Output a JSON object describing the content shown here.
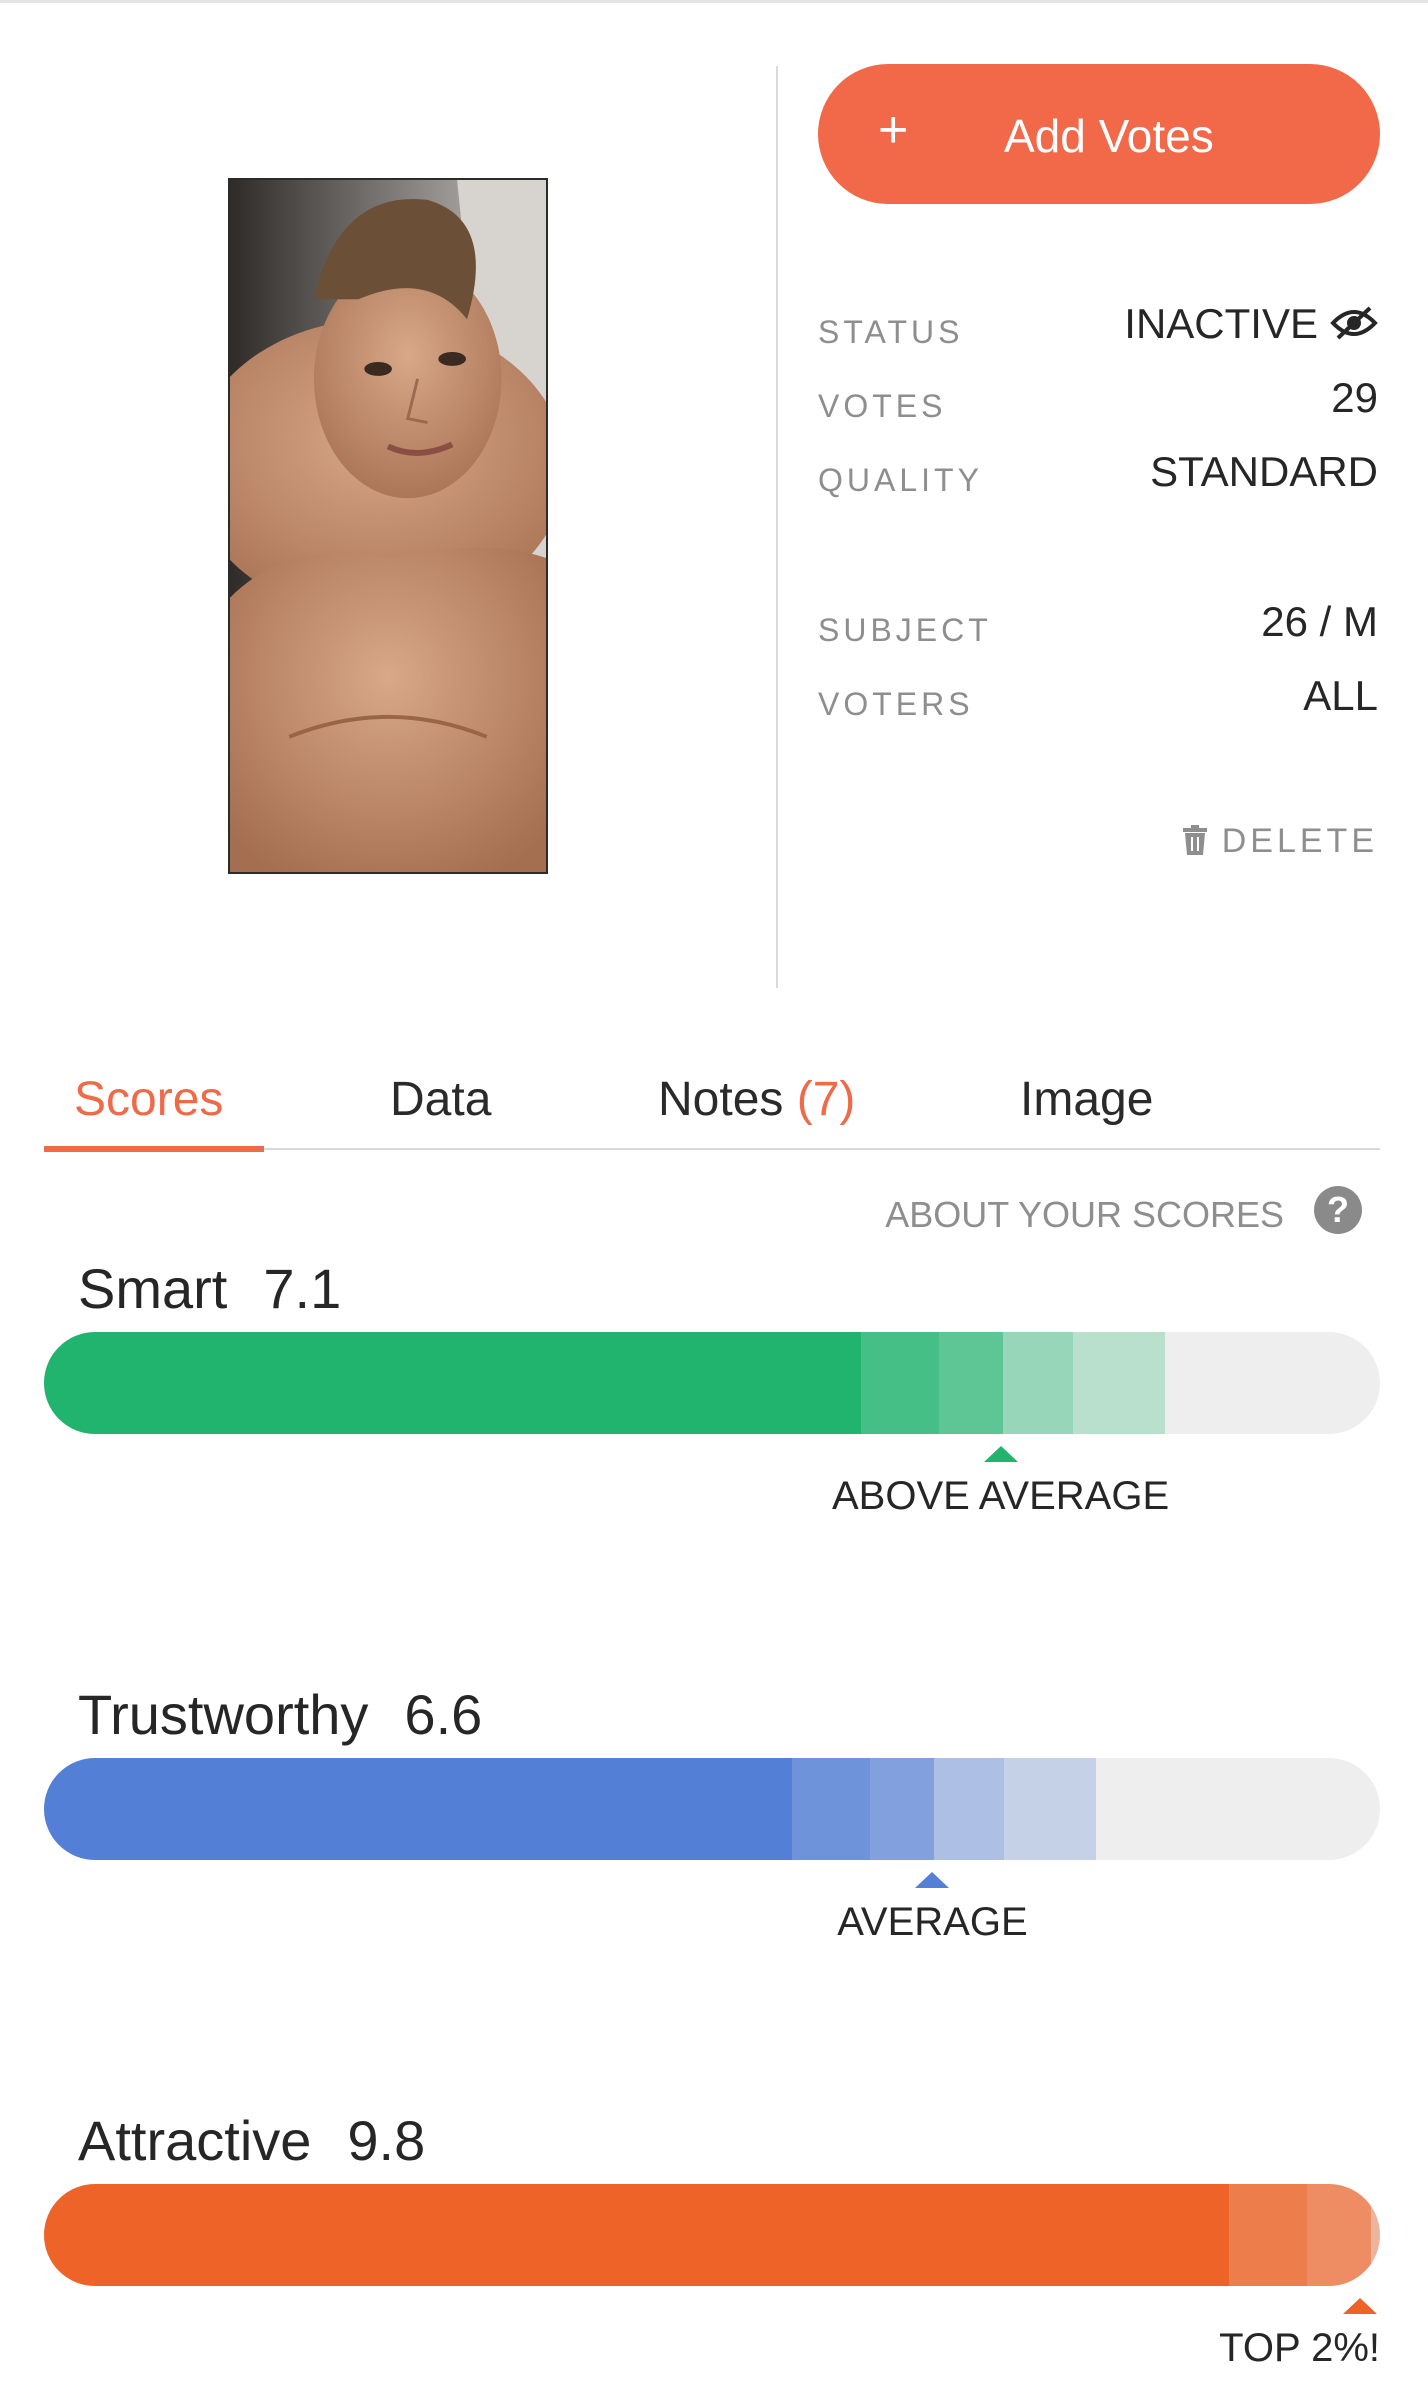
{
  "header": {
    "add_votes_icon": "+",
    "add_votes_label": "Add Votes"
  },
  "info": {
    "status_label": "STATUS",
    "status_value": "INACTIVE",
    "status_icon": "eye-slash-icon",
    "votes_label": "VOTES",
    "votes_value": "29",
    "quality_label": "QUALITY",
    "quality_value": "STANDARD",
    "subject_label": "SUBJECT",
    "subject_value": "26 / M",
    "voters_label": "VOTERS",
    "voters_value": "ALL"
  },
  "delete_label": "DELETE",
  "tabs": [
    {
      "label": "Scores",
      "active": true
    },
    {
      "label": "Data"
    },
    {
      "label": "Notes",
      "count": "(7)"
    },
    {
      "label": "Image"
    }
  ],
  "about_scores": "ABOUT YOUR SCORES",
  "scores": [
    {
      "name": "Smart",
      "value": "7.1",
      "label": "ABOVE AVERAGE",
      "color": "#21b46f",
      "percentile": 0.716
    },
    {
      "name": "Trustworthy",
      "value": "6.6",
      "label": "AVERAGE",
      "color": "#537fd6",
      "percentile": 0.665
    },
    {
      "name": "Attractive",
      "value": "9.8",
      "label": "TOP 2%!",
      "color": "#ee6428",
      "percentile": 0.992
    }
  ],
  "colors": {
    "accent": "#f2694a",
    "smart": "#21b46f",
    "trustworthy": "#537fd6",
    "attractive": "#ee6428"
  }
}
